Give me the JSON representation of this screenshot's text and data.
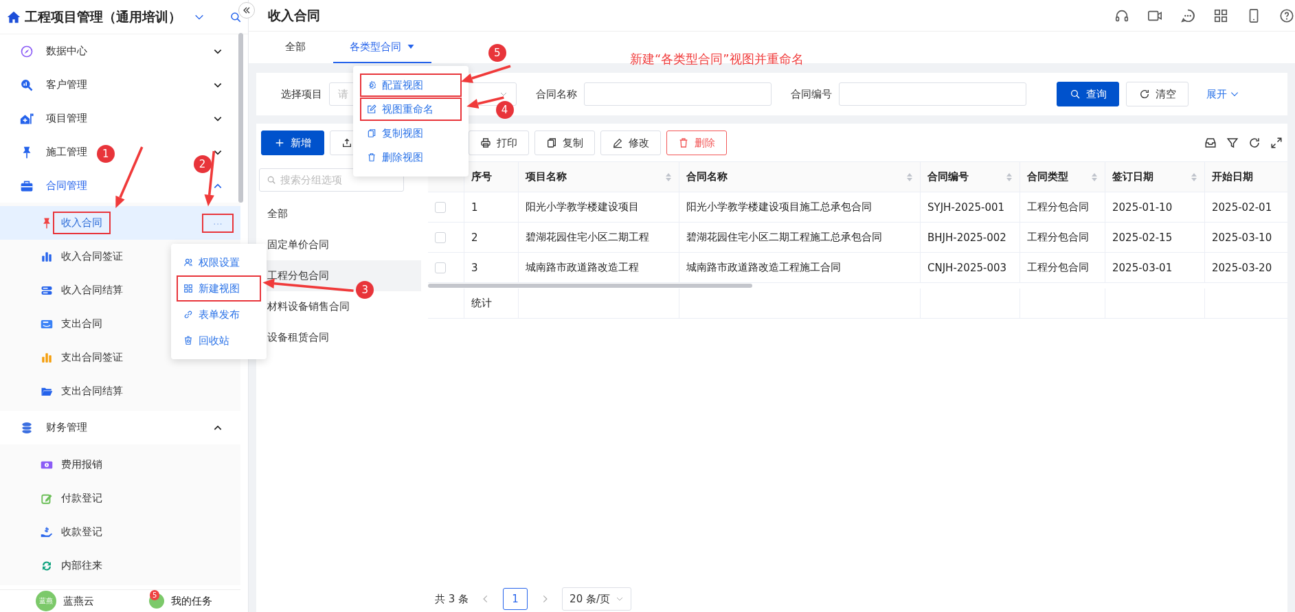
{
  "sidebar": {
    "title": "工程项目管理（通用培训）",
    "groups": [
      {
        "label": "数据中心",
        "expanded": false,
        "active": false
      },
      {
        "label": "客户管理",
        "expanded": false,
        "active": false
      },
      {
        "label": "项目管理",
        "expanded": false,
        "active": false
      },
      {
        "label": "施工管理",
        "expanded": false,
        "active": false
      },
      {
        "label": "合同管理",
        "expanded": true,
        "active": true,
        "children": [
          {
            "label": "收入合同",
            "selected": true,
            "boxed": true,
            "more": {
              "label": "···",
              "boxed": true
            }
          },
          {
            "label": "收入合同签证",
            "selected": false,
            "boxed": false
          },
          {
            "label": "收入合同结算",
            "selected": false,
            "boxed": false
          },
          {
            "label": "支出合同",
            "selected": false,
            "boxed": false
          },
          {
            "label": "支出合同签证",
            "selected": false,
            "boxed": false
          },
          {
            "label": "支出合同结算",
            "selected": false,
            "boxed": false
          }
        ]
      },
      {
        "label": "财务管理",
        "expanded": true,
        "active": false,
        "children": [
          {
            "label": "费用报销",
            "selected": false,
            "boxed": false
          },
          {
            "label": "付款登记",
            "selected": false,
            "boxed": false
          },
          {
            "label": "收款登记",
            "selected": false,
            "boxed": false
          },
          {
            "label": "内部往来",
            "selected": false,
            "boxed": false
          }
        ]
      }
    ],
    "context_menu": [
      {
        "label": "权限设置",
        "boxed": false
      },
      {
        "label": "新建视图",
        "boxed": true
      },
      {
        "label": "表单发布",
        "boxed": false
      },
      {
        "label": "回收站",
        "boxed": false
      }
    ],
    "footer": {
      "avatar": "蓝燕",
      "user": "蓝燕云",
      "tasks": "我的任务",
      "badge": "5"
    }
  },
  "header": {
    "title": "收入合同"
  },
  "tabs": [
    {
      "label": "全部",
      "selected": false,
      "has_menu": false
    },
    {
      "label": "各类型合同",
      "selected": true,
      "has_menu": true
    }
  ],
  "view_menu": [
    {
      "label": "配置视图",
      "boxed": true
    },
    {
      "label": "视图重命名",
      "boxed": true
    },
    {
      "label": "复制视图",
      "boxed": false
    },
    {
      "label": "删除视图",
      "boxed": false
    }
  ],
  "filters": [
    {
      "label": "选择项目",
      "kind": "select",
      "placeholder": "请"
    },
    {
      "label": "合同名称",
      "kind": "text"
    },
    {
      "label": "合同编号",
      "kind": "text"
    }
  ],
  "filter_buttons": [
    {
      "label": "查询",
      "kind": "primary"
    },
    {
      "label": "清空",
      "kind": "default"
    }
  ],
  "expand_link": "展开",
  "toolbar": [
    {
      "label": "新增",
      "kind": "primary"
    },
    {
      "kind": "upload"
    },
    {
      "label": "打印",
      "kind": "default"
    },
    {
      "label": "复制",
      "kind": "default"
    },
    {
      "label": "修改",
      "kind": "default"
    },
    {
      "label": "删除",
      "kind": "danger"
    }
  ],
  "group_panel": {
    "placeholder": "搜索分组选项",
    "items": [
      {
        "label": "全部",
        "selected": false
      },
      {
        "label": "固定单价合同",
        "selected": false
      },
      {
        "label": "工程分包合同",
        "selected": true
      },
      {
        "label": "材料设备销售合同",
        "selected": false
      },
      {
        "label": "设备租赁合同",
        "selected": false
      }
    ]
  },
  "table": {
    "columns": [
      "序号",
      "项目名称",
      "合同名称",
      "合同编号",
      "合同类型",
      "签订日期",
      "开始日期"
    ],
    "rows": [
      {
        "selected": false,
        "cells": [
          "1",
          "阳光小学教学楼建设项目",
          "阳光小学教学楼建设项目施工总承包合同",
          "SYJH-2025-001",
          "工程分包合同",
          "2025-01-10",
          "2025-02-01"
        ]
      },
      {
        "selected": false,
        "cells": [
          "2",
          "碧湖花园住宅小区二期工程",
          "碧湖花园住宅小区二期工程施工总承包合同",
          "BHJH-2025-002",
          "工程分包合同",
          "2025-02-15",
          "2025-03-10"
        ]
      },
      {
        "selected": false,
        "cells": [
          "3",
          "城南路市政道路改造工程",
          "城南路市政道路改造工程施工合同",
          "CNJH-2025-003",
          "工程分包合同",
          "2025-03-01",
          "2025-03-20"
        ]
      }
    ],
    "summary_label": "统计"
  },
  "pagination": {
    "total": "共 3 条",
    "pages": [
      {
        "label": "1",
        "selected": true
      }
    ],
    "page_size": "20 条/页"
  },
  "annotations": {
    "note": "新建“各类型合同”视图并重命名",
    "markers": [
      "1",
      "2",
      "3",
      "4",
      "5"
    ]
  }
}
